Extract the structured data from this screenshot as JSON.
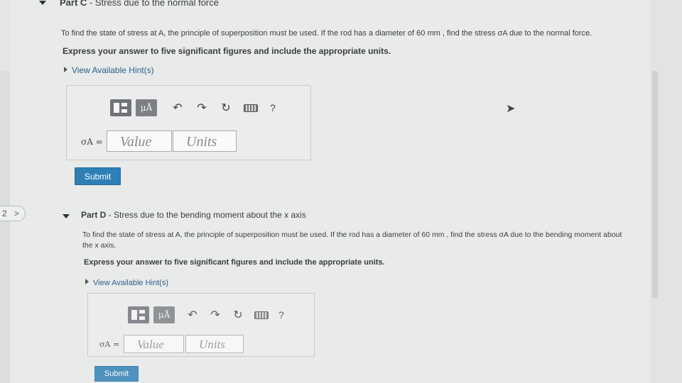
{
  "partC": {
    "prefix": "Part C",
    "title": " - Stress due to the normal force",
    "question": "To find the state of stress at A, the principle of superposition must be used. If the rod has a diameter of 60 mm , find the stress σA due to the normal force.",
    "express": "Express your answer to five significant figures and include the appropriate units.",
    "hint": "View Available Hint(s)",
    "label": "σA =",
    "value_placeholder": "Value",
    "units_placeholder": "Units",
    "submit": "Submit"
  },
  "partD": {
    "prefix": "Part D",
    "title": " - Stress due to the bending moment about the x axis",
    "question": "To find the state of stress at A, the principle of superposition must be used. If the rod has a diameter of 60 mm , find the stress σA due to the bending moment about the x axis.",
    "express": "Express your answer to five significant figures and include the appropriate units.",
    "hint": "View Available Hint(s)",
    "label": "σA =",
    "value_placeholder": "Value",
    "units_placeholder": "Units",
    "submit": "Submit"
  },
  "toolbar": {
    "mu_label": "μÅ",
    "undo_icon": "↶",
    "redo_icon": "↷",
    "reset_icon": "↻",
    "help_label": "?"
  },
  "pager": {
    "number": "2",
    "arrow": ">"
  }
}
